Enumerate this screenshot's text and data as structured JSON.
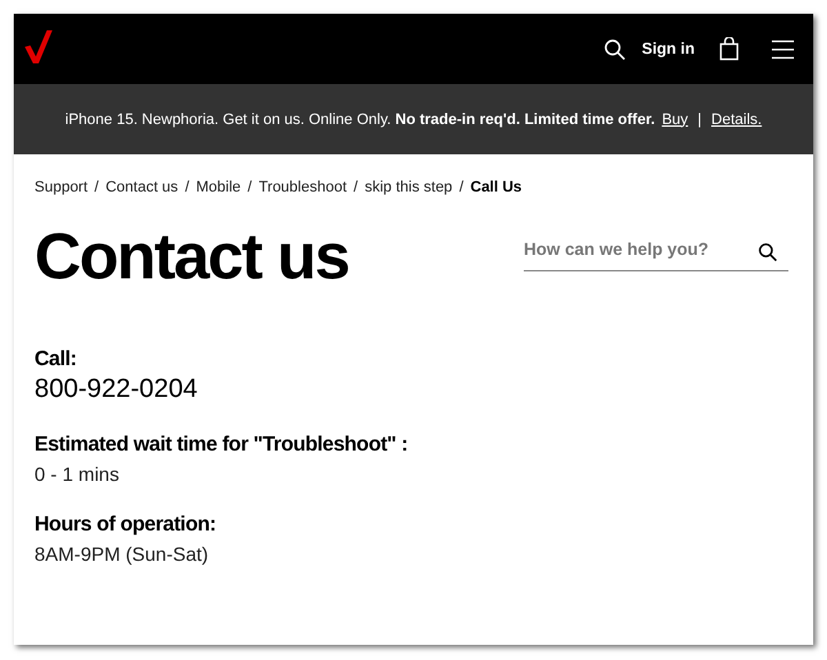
{
  "header": {
    "sign_in": "Sign in"
  },
  "promo": {
    "text": "iPhone 15. Newphoria. Get it on us. Online Only. **No trade-in req'd. Limited time offer.**",
    "links": [
      "Buy",
      "Details."
    ],
    "divider": "|"
  },
  "breadcrumb": {
    "separator": "/",
    "items": [
      {
        "label": "Support",
        "selected": false
      },
      {
        "label": "Contact us",
        "selected": false
      },
      {
        "label": "Mobile",
        "selected": false
      },
      {
        "label": "Troubleshoot",
        "selected": false
      },
      {
        "label": "skip this step",
        "selected": false
      },
      {
        "label": "Call Us",
        "selected": true
      }
    ]
  },
  "title": "Contact us",
  "search": {
    "placeholder": "How can we help you?"
  },
  "info": [
    {
      "label": "Call:",
      "value": "800-922-0204",
      "kind": "phone"
    },
    {
      "label": "Estimated wait time for \"Troubleshoot\" :",
      "value": "0 - 1 mins",
      "kind": "text"
    },
    {
      "label": "Hours of operation:",
      "value": "8AM-9PM (Sun-Sat)",
      "kind": "text"
    }
  ]
}
